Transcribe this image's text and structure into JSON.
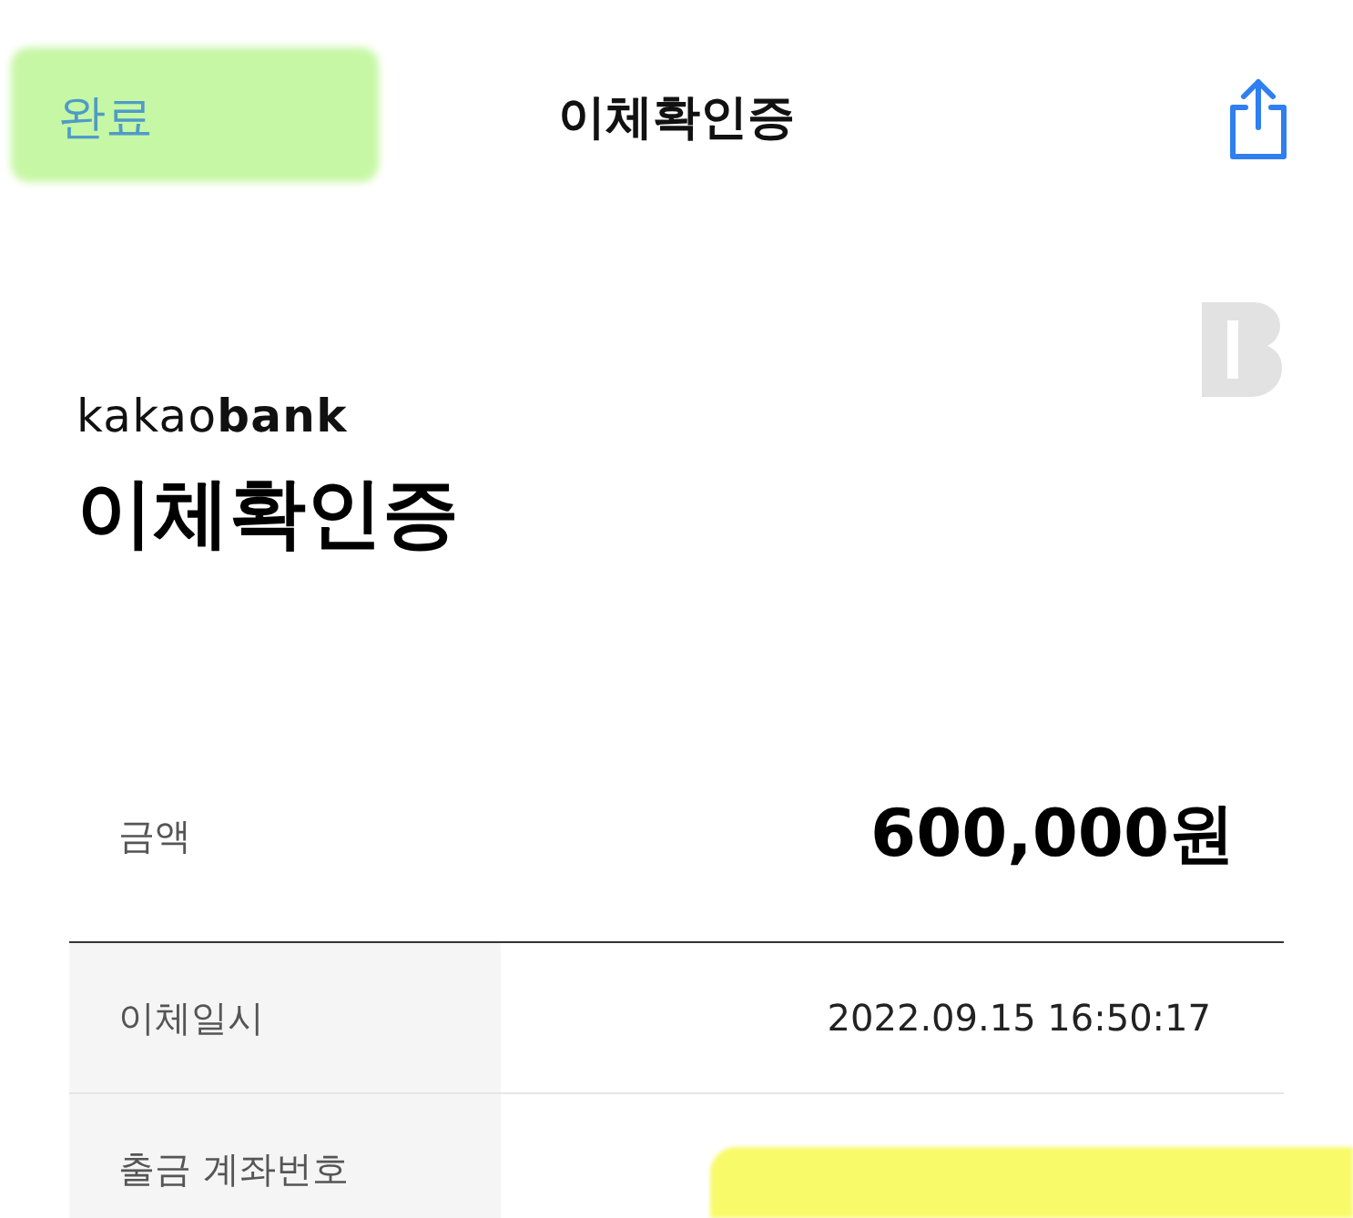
{
  "nav": {
    "done": "완료",
    "title": "이체확인증"
  },
  "brand": "kakao**bank**",
  "heading": "이체확인증",
  "amount": {
    "label": "금액",
    "value": "600,000원"
  },
  "rows": [
    {
      "label": "이체일시",
      "value": "2022.09.15 16:50:17"
    },
    {
      "label": "출금 계좌번호"
    }
  ]
}
